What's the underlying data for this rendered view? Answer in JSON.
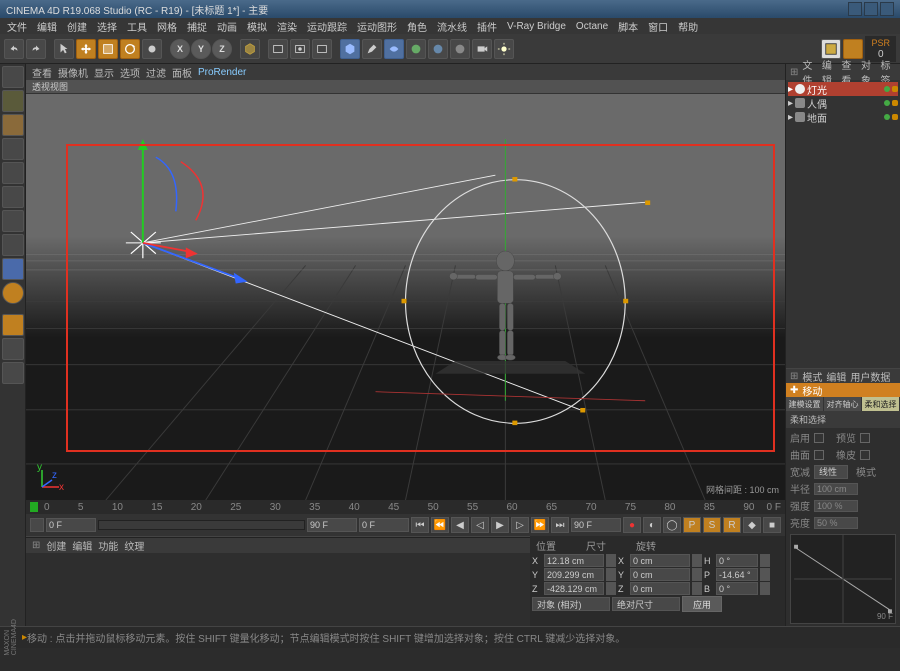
{
  "title": "CINEMA 4D R19.068 Studio (RC - R19) - [未标题 1*] - 主要",
  "menu": [
    "文件",
    "编辑",
    "创建",
    "选择",
    "工具",
    "网格",
    "捕捉",
    "动画",
    "模拟",
    "渲染",
    "运动跟踪",
    "运动图形",
    "角色",
    "流水线",
    "插件",
    "V-Ray Bridge",
    "Octane",
    "脚本",
    "窗口",
    "帮助"
  ],
  "toolbar": {
    "xyz": [
      "X",
      "Y",
      "Z"
    ],
    "psr_label": "PSR",
    "psr_value": "0"
  },
  "view_menu": [
    "查看",
    "摄像机",
    "显示",
    "选项",
    "过滤",
    "面板",
    "ProRender"
  ],
  "view_title": "透视视图",
  "grid_label": "网格间距 : 100 cm",
  "right_menu": [
    "文件",
    "编辑",
    "查看",
    "对象",
    "标签"
  ],
  "objects": [
    {
      "name": "灯光",
      "type": "light"
    },
    {
      "name": "人偶",
      "type": "obj"
    },
    {
      "name": "地面",
      "type": "obj"
    }
  ],
  "timeline": {
    "marks": [
      "0",
      "5",
      "10",
      "15",
      "20",
      "25",
      "30",
      "35",
      "40",
      "45",
      "50",
      "55",
      "60",
      "65",
      "70",
      "75",
      "80",
      "85",
      "90"
    ],
    "start": "0 F",
    "cur": "0 F",
    "end1": "90 F",
    "end2": "90 F"
  },
  "bottom_tabs": [
    "创建",
    "编辑",
    "功能",
    "纹理"
  ],
  "coords": {
    "head": [
      "位置",
      "尺寸",
      "旋转"
    ],
    "rows": [
      {
        "axis": "X",
        "pos": "12.18 cm",
        "size": "0 cm",
        "rot": "0 °",
        "rlabel": "H"
      },
      {
        "axis": "Y",
        "pos": "209.299 cm",
        "size": "0 cm",
        "rot": "-14.64 °",
        "rlabel": "P"
      },
      {
        "axis": "Z",
        "pos": "-428.129 cm",
        "size": "0 cm",
        "rot": "0 °",
        "rlabel": "B"
      }
    ],
    "mode1": "对象 (相对)",
    "mode2": "绝对尺寸",
    "apply": "应用"
  },
  "attr": {
    "menu": [
      "模式",
      "编辑",
      "用户数据"
    ],
    "title": "移动",
    "tabs": [
      "建模设置",
      "对齐轴心",
      "柔和选择"
    ],
    "section": "柔和选择",
    "rows": {
      "enable": "启用",
      "preview": "预览",
      "curve_l": "曲面",
      "erase_l": "橡皮",
      "width_l": "宽减",
      "width_mode": "线性",
      "mode_l": "模式",
      "radius_l": "半径",
      "radius_v": "100 cm",
      "strength_l": "强度",
      "strength_v": "100 %",
      "bright_l": "亮度",
      "bright_v": "50 %"
    },
    "curve_end": "90 F"
  },
  "status": "移动 : 点击并拖动鼠标移动元素。按住 SHIFT 键量化移动；节点编辑模式时按住 SHIFT 键增加选择对象；按住 CTRL 键减少选择对象。",
  "brand": "MAXON CINEMA4D"
}
